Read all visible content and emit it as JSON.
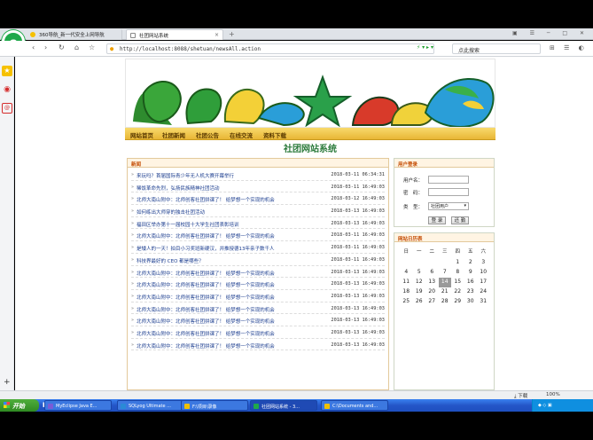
{
  "browser": {
    "tabs": [
      {
        "label": "360导航_新一代安全上网导航"
      },
      {
        "label": "社团网站系统"
      }
    ],
    "new_tab": "+",
    "url": "http://localhost:8088/shetuan/newsAll.action",
    "search_placeholder": "点此搜索"
  },
  "site": {
    "nav": [
      "网站首页",
      "社团新闻",
      "社团公告",
      "在线交流",
      "资料下载"
    ],
    "title": "社团网站系统",
    "news": {
      "heading": "新闻",
      "items": [
        {
          "title": "来玩吗？首届国际青少年无人机大赛开幕举行",
          "time": "2018-03-11 06:34:31"
        },
        {
          "title": "稀饭革命先烈，弘扬民族精神社团活动",
          "time": "2018-03-11 16:49:03"
        },
        {
          "title": "北师大南山附中：北师创客社团拼课了！ 给梦想一个实现的机会",
          "time": "2018-03-12 16:49:03"
        },
        {
          "title": "如何练出大师穿的独击社团活动",
          "time": "2018-03-13 16:49:03"
        },
        {
          "title": "福田区举办第十一届校园十大学生社团表彰培训",
          "time": "2018-03-13 16:49:03"
        },
        {
          "title": "北师大南山附中：北师创客社团拼课了！ 给梦想一个实现的机会",
          "time": "2018-03-11 16:49:03"
        },
        {
          "title": "是矮人的一天！拍目小习奖班新硬汉，并推授德13年亲子数千人",
          "time": "2018-03-11 16:49:03"
        },
        {
          "title": "科技界最好的 CEO 都是哪些？",
          "time": "2018-03-11 16:49:03"
        },
        {
          "title": "北师大南山附中：北师创客社团拼课了！ 给梦想一个实现的机会",
          "time": "2018-03-13 16:49:03"
        },
        {
          "title": "北师大南山附中：北师创客社团拼课了！ 给梦想一个实现的机会",
          "time": "2018-03-13 16:49:03"
        },
        {
          "title": "北师大南山附中：北师创客社团拼课了！ 给梦想一个实现的机会",
          "time": "2018-03-13 16:49:03"
        },
        {
          "title": "北师大南山附中：北师创客社团拼课了！ 给梦想一个实现的机会",
          "time": "2018-03-13 16:49:03"
        },
        {
          "title": "北师大南山附中：北师创客社团拼课了！ 给梦想一个实现的机会",
          "time": "2018-03-13 16:49:03"
        },
        {
          "title": "北师大南山附中：北师创客社团拼课了！ 给梦想一个实现的机会",
          "time": "2018-03-13 16:49:03"
        },
        {
          "title": "北师大南山附中：北师创客社团拼课了！ 给梦想一个实现的机会",
          "time": "2018-03-13 16:49:03"
        }
      ]
    },
    "login": {
      "heading": "用户登录",
      "username_label": "用户名：",
      "password_label": "密　码：",
      "type_label": "类　型：",
      "type_value": "社团用户",
      "login_button": "登 录",
      "reset_button": "还 勤"
    },
    "calendar": {
      "heading": "网站日历表",
      "weekdays": [
        "日",
        "一",
        "二",
        "三",
        "四",
        "五",
        "六"
      ],
      "rows": [
        [
          "",
          "",
          "",
          "",
          "1",
          "2",
          "3"
        ],
        [
          "4",
          "5",
          "6",
          "7",
          "8",
          "9",
          "10"
        ],
        [
          "11",
          "12",
          "13",
          "14",
          "15",
          "16",
          "17"
        ],
        [
          "18",
          "19",
          "20",
          "21",
          "22",
          "23",
          "24"
        ],
        [
          "25",
          "26",
          "27",
          "28",
          "29",
          "30",
          "31"
        ]
      ],
      "today": "14"
    }
  },
  "statusbar": {
    "download": "下载",
    "zoom": "100%"
  },
  "taskbar": {
    "start": "开始",
    "tasks": [
      {
        "label": "MyEclipse Java E...",
        "color": "#7a5bd6"
      },
      {
        "label": "SQLyog Ultimate ...",
        "color": "#2a8ad6"
      },
      {
        "label": "F:\\项目\\录像",
        "color": "#f0c000"
      },
      {
        "label": "社团网站系统 - 3...",
        "color": "#1fa84a"
      },
      {
        "label": "C:\\Documents and...",
        "color": "#f0c000"
      }
    ],
    "clock": ""
  }
}
